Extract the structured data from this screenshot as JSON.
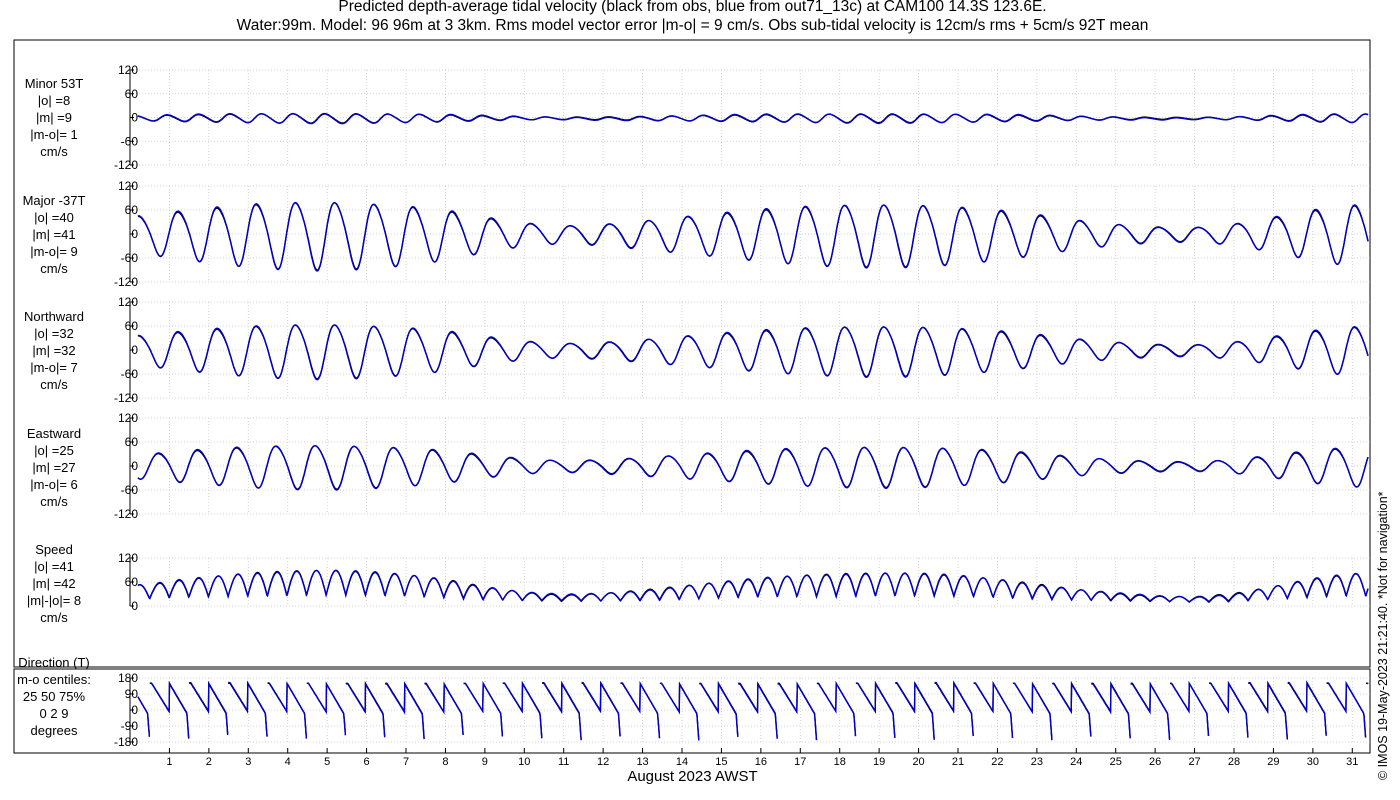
{
  "title_line1": "Predicted depth-average tidal velocity (black from obs, blue from out71_13c) at CAM100 14.3S 123.6E.",
  "title_line2": "Water:99m. Model: 96 96m at 3 3km. Rms model vector error |m-o| = 9 cm/s. Obs sub-tidal velocity is 12cm/s rms + 5cm/s 92T mean",
  "watermark": "© IMOS 19-May-2023 21:21:40.  *Not for navigation*",
  "colors": {
    "obs": "#000000",
    "model": "#0000cc",
    "grid": "#c8c8c8",
    "axis": "#000000"
  },
  "chart_data": {
    "type": "line",
    "xlabel": "August 2023 AWST",
    "x_range": [
      0,
      31.5
    ],
    "x_ticks": [
      "1",
      "2",
      "3",
      "4",
      "5",
      "6",
      "7",
      "8",
      "9",
      "10",
      "11",
      "12",
      "13",
      "14",
      "15",
      "16",
      "17",
      "18",
      "19",
      "20",
      "21",
      "22",
      "23",
      "24",
      "25",
      "26",
      "27",
      "28",
      "29",
      "30",
      "31"
    ],
    "series_legend": {
      "obs": "black from obs",
      "model": "blue from out71_13c"
    },
    "panels": [
      {
        "key": "minor",
        "label_lines": [
          "Minor 53T",
          "|o| =8",
          "|m| =9",
          "|m-o|= 1",
          "cm/s"
        ],
        "ylim": [
          -120,
          120
        ],
        "yticks": [
          120,
          60,
          0,
          -60,
          -120
        ],
        "ytick_labels": [
          "120",
          "60",
          "0",
          "-60",
          "-120"
        ],
        "kind": "velocity",
        "amplitude": 12,
        "period_days": 0.8,
        "phase": 0.3,
        "mean": -2
      },
      {
        "key": "major",
        "label_lines": [
          "Major -37T",
          "|o| =40",
          "|m| =41",
          "|m-o|= 9",
          "cm/s"
        ],
        "ylim": [
          -120,
          120
        ],
        "yticks": [
          120,
          60,
          0,
          -60,
          -120
        ],
        "ytick_labels": [
          "120",
          "60",
          "0",
          "-60",
          "-120"
        ],
        "kind": "velocity",
        "amplitude": 85,
        "period_days": 0.995,
        "phase": 0.0,
        "mean": 0
      },
      {
        "key": "northward",
        "label_lines": [
          "Northward",
          "|o| =32",
          "|m| =32",
          "|m-o|= 7",
          "cm/s"
        ],
        "ylim": [
          -120,
          120
        ],
        "yticks": [
          120,
          60,
          0,
          -60,
          -120
        ],
        "ytick_labels": [
          "120",
          "60",
          "0",
          "-60",
          "-120"
        ],
        "kind": "velocity",
        "amplitude": 68,
        "period_days": 0.995,
        "phase": 0.0,
        "mean": 0
      },
      {
        "key": "eastward",
        "label_lines": [
          "Eastward",
          "|o| =25",
          "|m| =27",
          "|m-o|= 6",
          "cm/s"
        ],
        "ylim": [
          -120,
          120
        ],
        "yticks": [
          120,
          60,
          0,
          -60,
          -120
        ],
        "ytick_labels": [
          "120",
          "60",
          "0",
          "-60",
          "-120"
        ],
        "kind": "velocity",
        "amplitude": 55,
        "period_days": 0.995,
        "phase": 3.14159,
        "mean": 0
      },
      {
        "key": "speed",
        "label_lines": [
          "Speed",
          "|o| =41",
          "|m| =42",
          "|m|-|o|= 8",
          "cm/s"
        ],
        "ylim": [
          0,
          120
        ],
        "yticks": [
          120,
          60,
          0
        ],
        "ytick_labels": [
          "120",
          "60",
          "0"
        ],
        "kind": "speed",
        "amplitude": 85,
        "period_days": 0.4975,
        "phase": 0.0,
        "mean": 0
      },
      {
        "key": "direction",
        "label_lines": [
          "Direction (T)",
          "m-o centiles:",
          "25  50  75%",
          "0  2  9",
          "degrees"
        ],
        "ylim": [
          -180,
          180
        ],
        "yticks": [
          180,
          90,
          0,
          -90,
          -180
        ],
        "ytick_labels": [
          "180",
          "90",
          "0",
          "-90",
          "-180"
        ],
        "kind": "direction",
        "amplitude": 180,
        "period_days": 0.995,
        "phase": 0.0,
        "mean": 0
      }
    ],
    "envelope": {
      "description": "spring-neap modulation of tidal amplitude",
      "day_values": [
        0.5,
        1,
        2,
        3,
        4,
        5,
        6,
        7,
        8,
        9,
        10,
        11,
        12,
        13,
        14,
        15,
        16,
        17,
        18,
        19,
        20,
        21,
        22,
        23,
        24,
        25,
        26,
        27,
        28,
        29,
        30,
        31,
        31.5
      ],
      "amp_fraction": [
        0.55,
        0.65,
        0.78,
        0.9,
        0.96,
        0.98,
        0.93,
        0.85,
        0.72,
        0.5,
        0.33,
        0.25,
        0.3,
        0.4,
        0.52,
        0.63,
        0.74,
        0.83,
        0.88,
        0.9,
        0.88,
        0.82,
        0.72,
        0.58,
        0.42,
        0.3,
        0.22,
        0.2,
        0.3,
        0.5,
        0.72,
        0.88,
        0.85
      ]
    }
  }
}
